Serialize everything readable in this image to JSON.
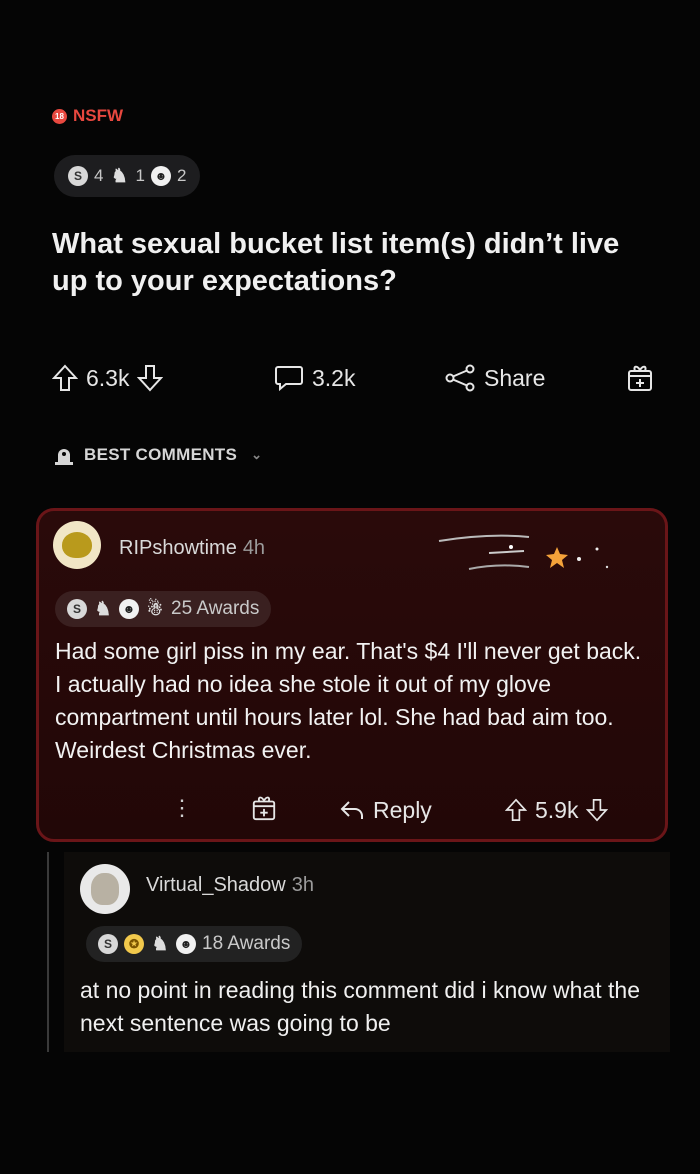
{
  "post": {
    "nsfw_label": "NSFW",
    "nsfw_icon_text": "18",
    "awards": [
      {
        "icon": "silver-award-icon",
        "count": "4"
      },
      {
        "icon": "helpful-award-icon",
        "count": "1"
      },
      {
        "icon": "wholesome-award-icon",
        "count": "2"
      }
    ],
    "title": "What sexual bucket list item(s) didn’t live up to your expectations?",
    "upvotes": "6.3k",
    "comments": "3.2k",
    "share_label": "Share"
  },
  "sort": {
    "label": "BEST COMMENTS"
  },
  "comment1": {
    "author": "RIPshowtime",
    "age": "4h",
    "awards_label": "25 Awards",
    "award_icons": [
      "silver-award-icon",
      "helpful-award-icon",
      "wholesome-award-icon",
      "christmas-award-icon"
    ],
    "body": "Had some girl piss in my ear. That's $4 I'll never get back. I actually had no idea she stole it out of my glove compartment until hours later lol. She had bad aim too. Weirdest Christmas ever.",
    "reply_label": "Reply",
    "score": "5.9k"
  },
  "comment2": {
    "author": "Virtual_Shadow",
    "age": "3h",
    "awards_label": "18 Awards",
    "award_icons": [
      "silver-award-icon",
      "gold-award-icon",
      "helpful-award-icon",
      "wholesome-award-icon"
    ],
    "body": "at no point in reading this comment did i know what the next sentence was going to be"
  },
  "colors": {
    "nsfw": "#e8483f",
    "highlight_border": "#6a1518",
    "background": "#050505"
  }
}
